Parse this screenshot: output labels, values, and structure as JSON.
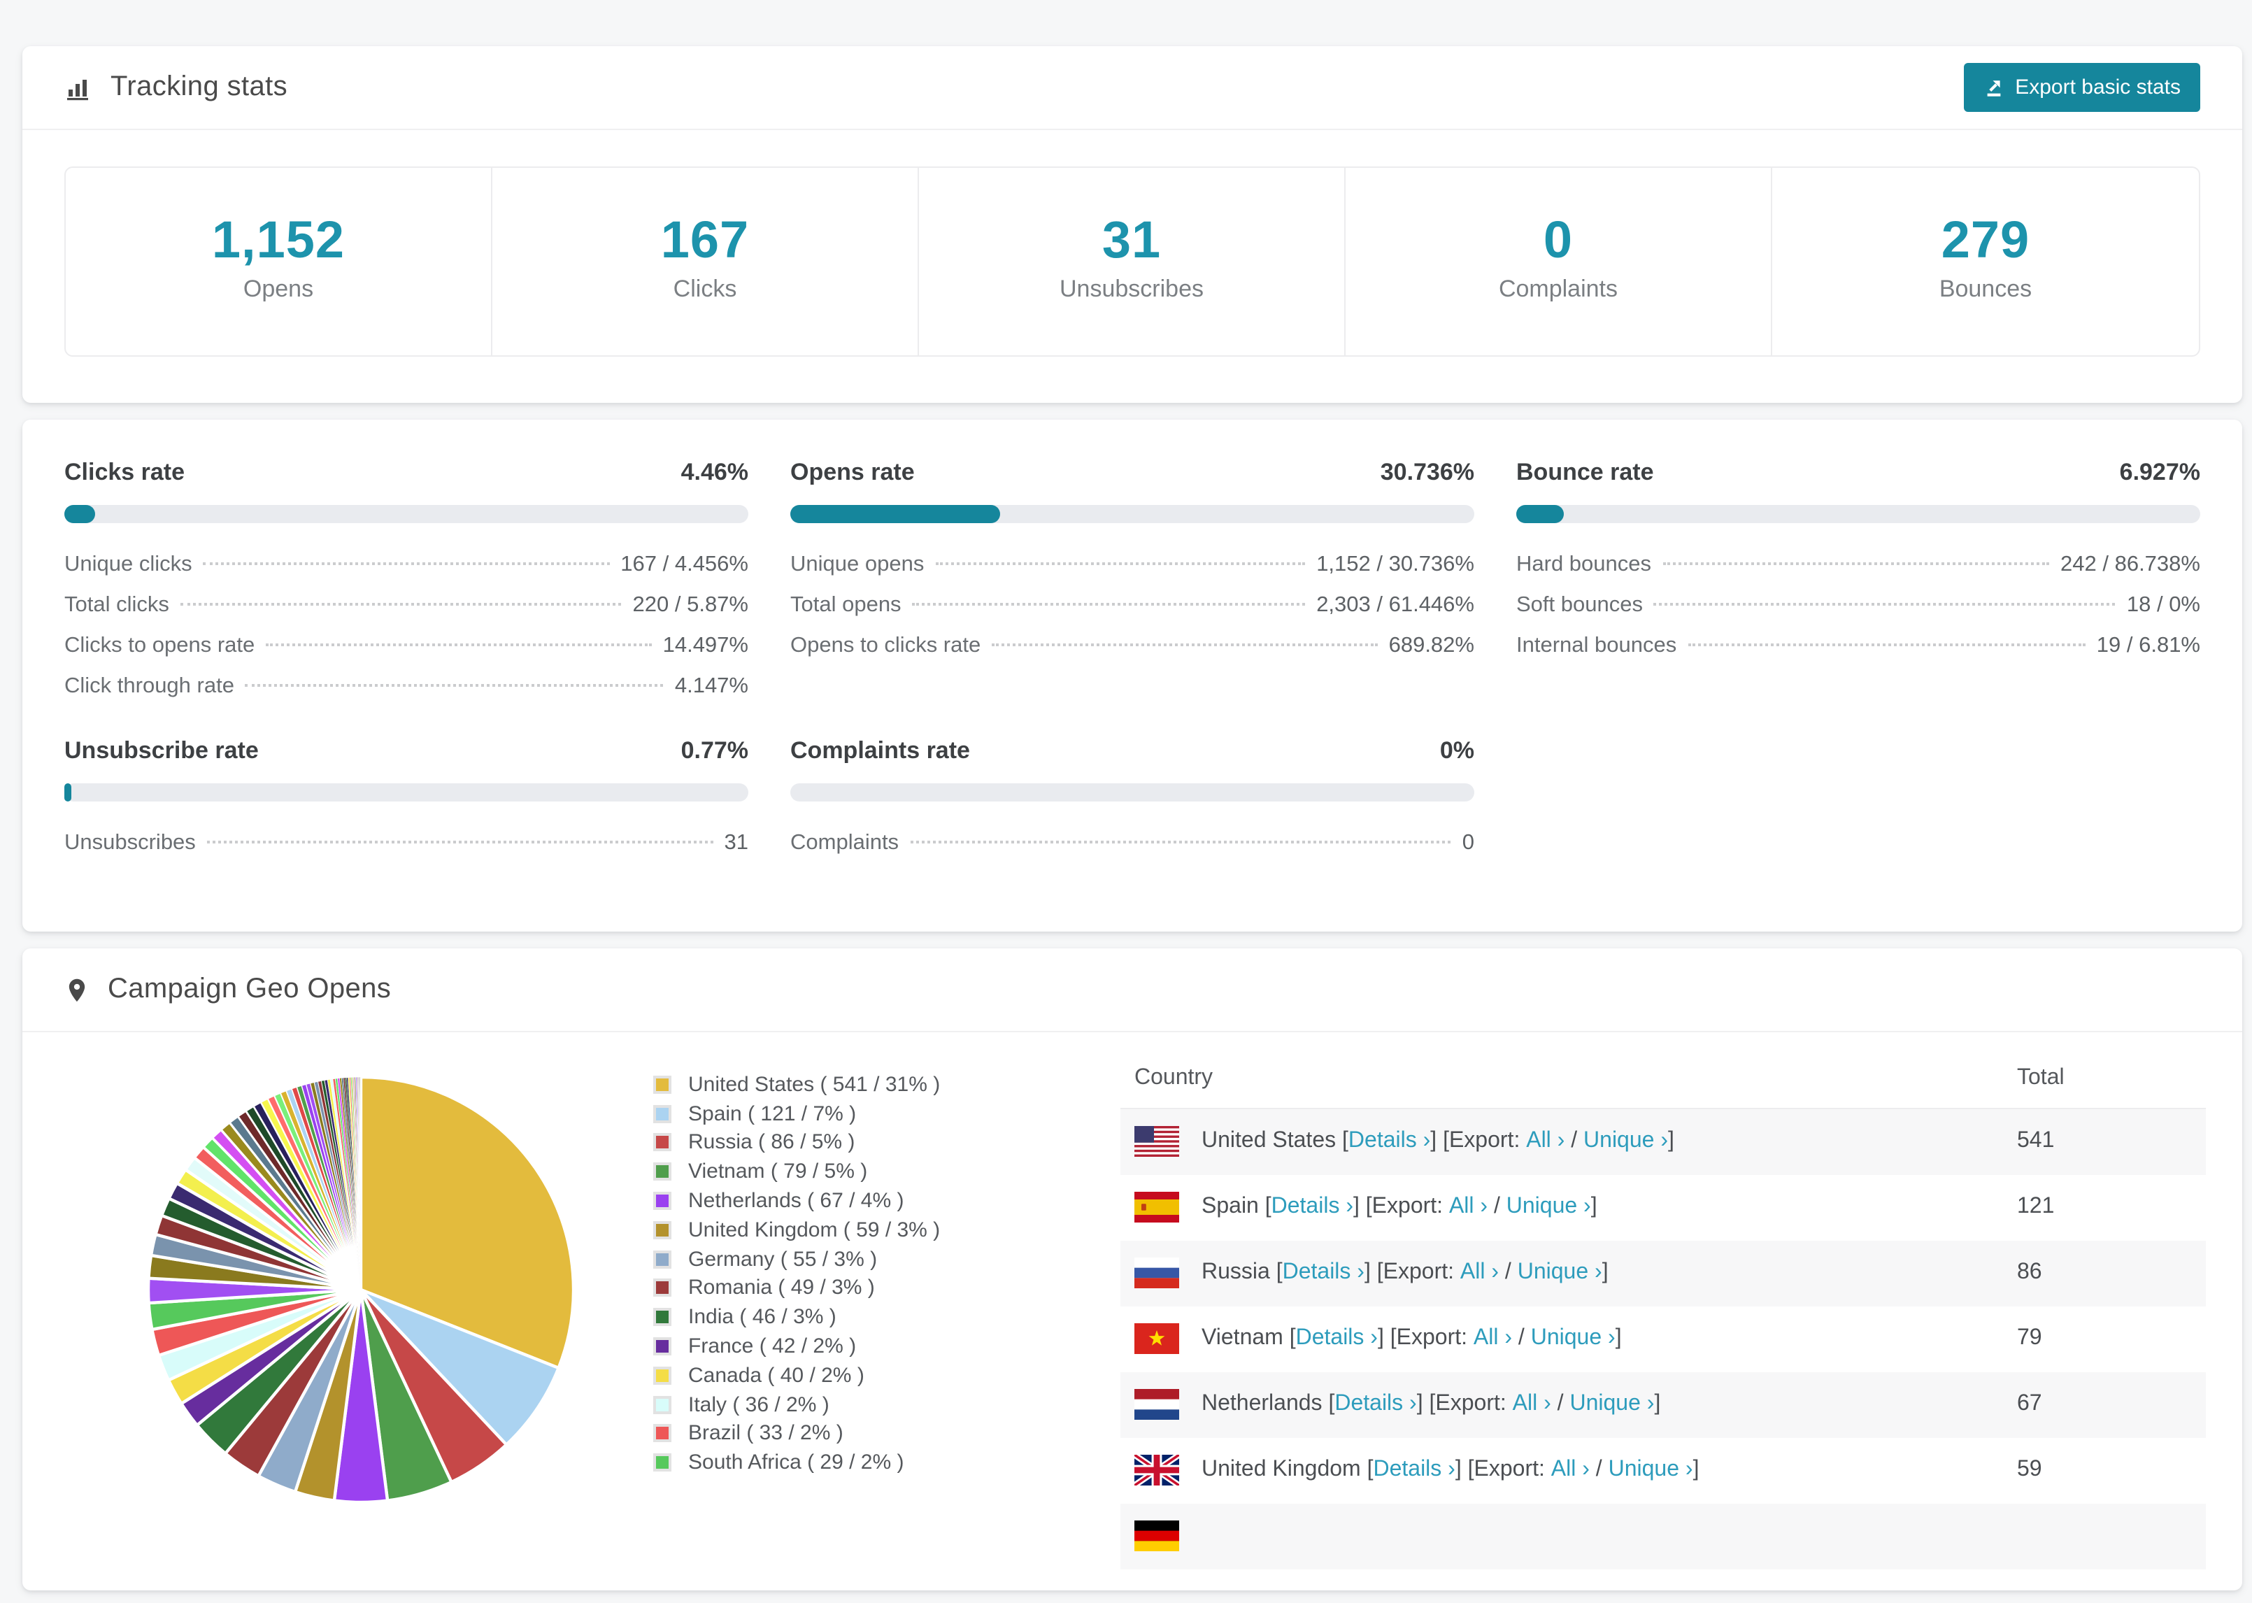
{
  "colors": {
    "accent_number": "#1d93ac",
    "accent_dark": "#15869c",
    "link": "#2d9cbc",
    "bar_track": "#e9ebef"
  },
  "tracking": {
    "title": "Tracking stats",
    "export_label": "Export basic stats",
    "stats": [
      {
        "value": "1,152",
        "label": "Opens"
      },
      {
        "value": "167",
        "label": "Clicks"
      },
      {
        "value": "31",
        "label": "Unsubscribes"
      },
      {
        "value": "0",
        "label": "Complaints"
      },
      {
        "value": "279",
        "label": "Bounces"
      }
    ]
  },
  "rates": [
    {
      "title": "Clicks rate",
      "value": "4.46%",
      "percent": 4.46,
      "rows": [
        {
          "label": "Unique clicks",
          "value": "167 / 4.456%"
        },
        {
          "label": "Total clicks",
          "value": "220 / 5.87%"
        },
        {
          "label": "Clicks to opens rate",
          "value": "14.497%"
        },
        {
          "label": "Click through rate",
          "value": "4.147%"
        }
      ]
    },
    {
      "title": "Opens rate",
      "value": "30.736%",
      "percent": 30.736,
      "rows": [
        {
          "label": "Unique opens",
          "value": "1,152 / 30.736%"
        },
        {
          "label": "Total opens",
          "value": "2,303 / 61.446%"
        },
        {
          "label": "Opens to clicks rate",
          "value": "689.82%"
        }
      ]
    },
    {
      "title": "Bounce rate",
      "value": "6.927%",
      "percent": 6.927,
      "rows": [
        {
          "label": "Hard bounces",
          "value": "242 / 86.738%"
        },
        {
          "label": "Soft bounces",
          "value": "18 / 0%"
        },
        {
          "label": "Internal bounces",
          "value": "19 / 6.81%"
        }
      ]
    },
    {
      "title": "Unsubscribe rate",
      "value": "0.77%",
      "percent": 0.77,
      "rows": [
        {
          "label": "Unsubscribes",
          "value": "31"
        }
      ]
    },
    {
      "title": "Complaints rate",
      "value": "0%",
      "percent": 0,
      "rows": [
        {
          "label": "Complaints",
          "value": "0"
        }
      ]
    }
  ],
  "geo": {
    "title": "Campaign Geo Opens",
    "table": {
      "headers": [
        "Country",
        "Total"
      ],
      "labels": {
        "details": "Details",
        "export": "Export:",
        "all": "All",
        "unique": "Unique",
        "chevron": "›",
        "open_bracket": "[",
        "close_bracket": "]",
        "slash": "/"
      },
      "rows": [
        {
          "country": "United States",
          "flag": "us",
          "total": "541"
        },
        {
          "country": "Spain",
          "flag": "es",
          "total": "121"
        },
        {
          "country": "Russia",
          "flag": "ru",
          "total": "86"
        },
        {
          "country": "Vietnam",
          "flag": "vn",
          "total": "79"
        },
        {
          "country": "Netherlands",
          "flag": "nl",
          "total": "67"
        },
        {
          "country": "United Kingdom",
          "flag": "gb",
          "total": "59"
        },
        {
          "country": "",
          "flag": "de",
          "total": "",
          "partial": true
        }
      ]
    }
  },
  "chart_data": {
    "type": "pie",
    "title": "Campaign Geo Opens",
    "legend_position": "right",
    "start_angle_deg": -90,
    "direction": "clockwise",
    "slices": [
      {
        "label": "United States",
        "value": 541,
        "percent": 31,
        "color": "#e3bb3d"
      },
      {
        "label": "Spain",
        "value": 121,
        "percent": 7,
        "color": "#abd3f1"
      },
      {
        "label": "Russia",
        "value": 86,
        "percent": 5,
        "color": "#c64848"
      },
      {
        "label": "Vietnam",
        "value": 79,
        "percent": 5,
        "color": "#4f9e4c"
      },
      {
        "label": "Netherlands",
        "value": 67,
        "percent": 4,
        "color": "#9a41f0"
      },
      {
        "label": "United Kingdom",
        "value": 59,
        "percent": 3,
        "color": "#b3922c"
      },
      {
        "label": "Germany",
        "value": 55,
        "percent": 3,
        "color": "#8fabca"
      },
      {
        "label": "Romania",
        "value": 49,
        "percent": 3,
        "color": "#9c3a3a"
      },
      {
        "label": "India",
        "value": 46,
        "percent": 3,
        "color": "#31793b"
      },
      {
        "label": "France",
        "value": 42,
        "percent": 2,
        "color": "#672d9e"
      },
      {
        "label": "Canada",
        "value": 40,
        "percent": 2,
        "color": "#f4dd46"
      },
      {
        "label": "Italy",
        "value": 36,
        "percent": 2,
        "color": "#d8fcfa"
      },
      {
        "label": "Brazil",
        "value": 33,
        "percent": 2,
        "color": "#ee5757"
      },
      {
        "label": "South Africa",
        "value": 29,
        "percent": 2,
        "color": "#56c95c"
      }
    ],
    "others": {
      "total_percent": 26,
      "approx_count": 55,
      "palette": [
        "#a14ff2",
        "#8a7a1e",
        "#7a93ad",
        "#8f3535",
        "#245c2e",
        "#3a2a70",
        "#f3ef4e",
        "#e2fbfa",
        "#f25e5e",
        "#62e36a",
        "#d44ff2",
        "#9a8a1e",
        "#5b7a8e",
        "#6e2a2a",
        "#1e4a28",
        "#28205c",
        "#f7f74e",
        "#ff6b6b",
        "#7aef7a",
        "#d9b32e",
        "#abd3f1",
        "#e04848",
        "#4f9e4c",
        "#9a41f0"
      ]
    }
  }
}
